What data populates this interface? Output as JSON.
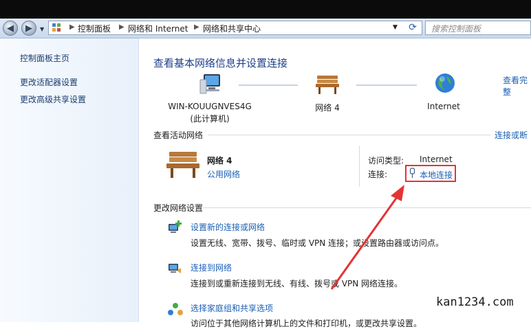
{
  "address_bar": {
    "breadcrumbs": [
      "控制面板",
      "网络和 Internet",
      "网络和共享中心"
    ],
    "search_placeholder": "搜索控制面板"
  },
  "left_pane": {
    "links": [
      "控制面板主页",
      "更改适配器设置",
      "更改高级共享设置"
    ]
  },
  "main": {
    "title": "查看基本网络信息并设置连接",
    "view_full_map": "查看完整",
    "network_map": {
      "computer_name": "WIN-KOUUGNVES4G",
      "computer_sub": "(此计算机)",
      "network_name": "网络  4",
      "internet": "Internet"
    },
    "active_networks": {
      "header": "查看活动网络",
      "connect_disconnect": "连接或断",
      "network_name": "网络  4",
      "network_category": "公用网络",
      "access_type_label": "访问类型:",
      "access_type_value": "Internet",
      "connections_label": "连接:",
      "connection_value": "本地连接"
    },
    "change_settings": {
      "header": "更改网络设置",
      "tasks": [
        {
          "title": "设置新的连接或网络",
          "desc": "设置无线、宽带、拨号、临时或 VPN 连接；或设置路由器或访问点。"
        },
        {
          "title": "连接到网络",
          "desc": "连接到或重新连接到无线、有线、拨号或 VPN 网络连接。"
        },
        {
          "title": "选择家庭组和共享选项",
          "desc": "访问位于其他网络计算机上的文件和打印机，或更改共享设置。"
        }
      ]
    }
  },
  "watermark": "kan1234.com",
  "colors": {
    "link": "#1a5fb4",
    "title": "#1e3f8a",
    "highlight": "#e53333",
    "arrow": "#e53333"
  }
}
